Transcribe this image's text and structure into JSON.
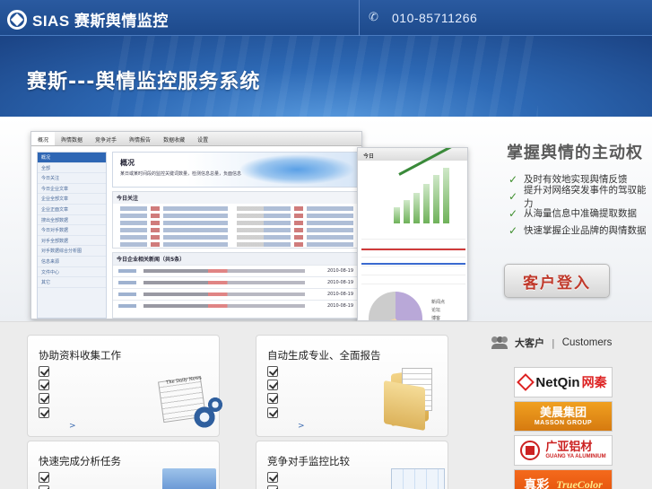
{
  "header": {
    "logo_text": "SIAS 赛斯舆情监控",
    "phone": "010-85711266"
  },
  "banner": {
    "title": "赛斯---舆情监控服务系统"
  },
  "mockup": {
    "nav": [
      "概况",
      "舆情数据",
      "竞争对手",
      "舆情报告",
      "数据收藏",
      "设置"
    ],
    "sidebar": [
      "概况",
      "全部",
      "今日关注",
      "今日企业文章",
      "企业全部文章",
      "企业正面文章",
      "搜出全部数据",
      "今日对手数据",
      "对手全部数据",
      "对手数据综合分析图",
      "信息来源",
      "文件中心",
      "其它"
    ],
    "overview_title": "概况",
    "overview_desc": "某日或某时间段的监控关键词数量，检测信息总量，负面信息",
    "today_focus": "今日关注",
    "today_articles": "今日企业相关新闻（共5条）",
    "dates": [
      "2010-08-19",
      "2010-08-19",
      "2010-08-19",
      "2010-08-19"
    ],
    "side_header": "今日",
    "pie_legend": [
      "新闻点",
      "论坛",
      "博客"
    ]
  },
  "showcase": {
    "slogan": "掌握舆情的主动权",
    "features": [
      "及时有效地实现舆情反馈",
      "提升对网络突发事件的驾驭能力",
      "从海量信息中准确提取数据",
      "快速掌握企业品牌的舆情数据"
    ],
    "login_label": "客户登入"
  },
  "cards": [
    {
      "title": "协助资料收集工作",
      "more": ">"
    },
    {
      "title": "自动生成专业、全面报告",
      "more": ">"
    },
    {
      "title": "快速完成分析任务",
      "more": ">"
    },
    {
      "title": "竞争对手监控比较",
      "more": ">"
    }
  ],
  "clients": {
    "title": "大客户",
    "separator": "|",
    "title_en": "Customers",
    "logos": [
      {
        "name": "NetQin网秦",
        "text_a": "NetQin",
        "text_b": "网秦"
      },
      {
        "name": "美晨集团 MASSON GROUP",
        "text_a": "美晨集团",
        "text_b": "MASSON GROUP"
      },
      {
        "name": "广亚铝材 GUANG YA ALUMINIUM",
        "text_a": "广亚铝材",
        "text_b": "GUANG YA ALUMINIUM"
      },
      {
        "name": "真彩 TrueColor",
        "text_a": "真彩",
        "text_b": "TrueColor"
      }
    ]
  },
  "colors": {
    "header_blue": "#1d4a8c",
    "accent_red": "#c0392b",
    "check_green": "#3f8f2e"
  }
}
